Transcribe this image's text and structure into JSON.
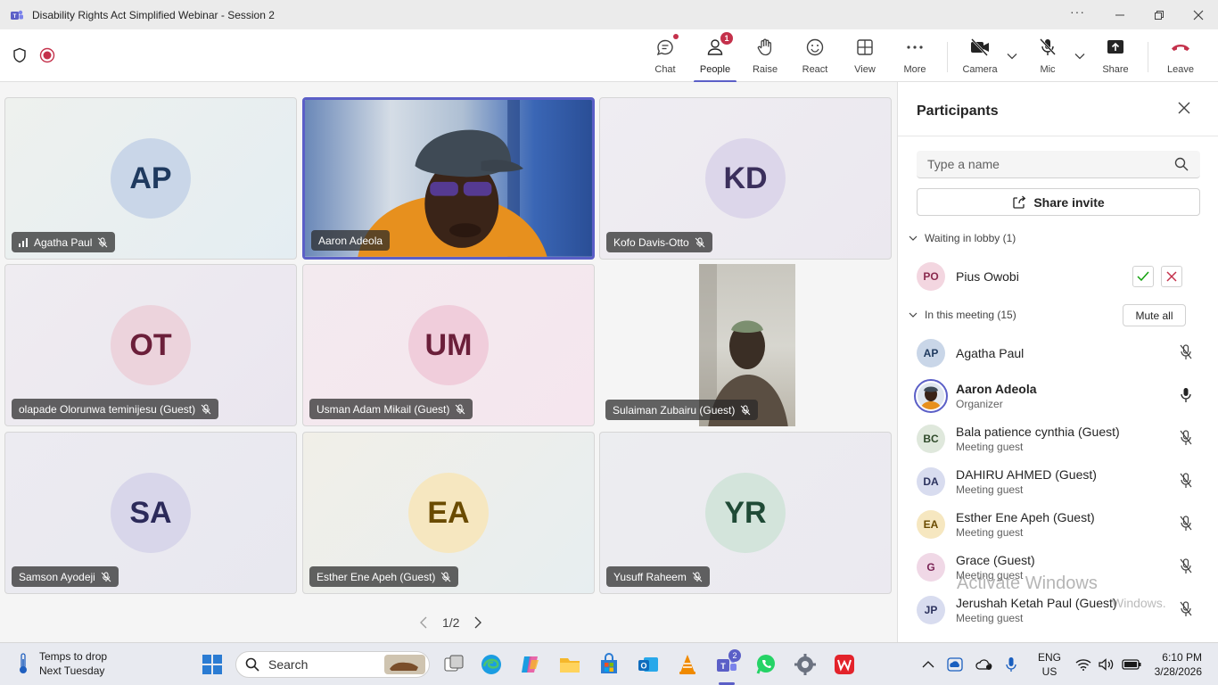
{
  "window": {
    "title": "Disability Rights Act Simplified Webinar - Session 2",
    "more_glyph": "···"
  },
  "toolbar": {
    "items": [
      {
        "label": "Chat",
        "icon": "chat-icon"
      },
      {
        "label": "People",
        "icon": "people-icon",
        "badge": "1"
      },
      {
        "label": "Raise",
        "icon": "raise-hand-icon"
      },
      {
        "label": "React",
        "icon": "react-emoji-icon"
      },
      {
        "label": "View",
        "icon": "view-grid-icon"
      },
      {
        "label": "More",
        "icon": "more-icon"
      },
      {
        "label": "Camera",
        "icon": "camera-off-icon"
      },
      {
        "label": "Mic",
        "icon": "mic-off-icon"
      },
      {
        "label": "Share",
        "icon": "share-icon"
      },
      {
        "label": "Leave",
        "icon": "leave-icon"
      }
    ]
  },
  "tiles": [
    {
      "name": "Agatha Paul",
      "initials": "AP",
      "bg": "#e9eff0",
      "avatar_bg": "#c9d6e8",
      "avatar_fg": "#1f3a5f",
      "signal": true
    },
    {
      "name": "Aaron Adeola",
      "video": true,
      "speaking": true
    },
    {
      "name": "Kofo Davis-Otto",
      "initials": "KD",
      "bg": "#eeecf2",
      "avatar_bg": "#dcd6ea",
      "avatar_fg": "#3b2f5c"
    },
    {
      "name": "olapade Olorunwa teminijesu (Guest)",
      "initials": "OT",
      "bg": "#efebf0",
      "avatar_bg": "#ecd3dc",
      "avatar_fg": "#6b1f3a"
    },
    {
      "name": "Usman Adam Mikail (Guest)",
      "initials": "UM",
      "bg": "#f3e9ee",
      "avatar_bg": "#f0cddb",
      "avatar_fg": "#6b1f3a"
    },
    {
      "name": "Sulaiman Zubairu (Guest)",
      "video": true
    },
    {
      "name": "Samson Ayodeji",
      "initials": "SA",
      "bg": "#ebebf2",
      "avatar_bg": "#d8d6ea",
      "avatar_fg": "#2c2a5a"
    },
    {
      "name": "Esther Ene Apeh (Guest)",
      "initials": "EA",
      "bg": "#eef0ec",
      "avatar_bg": "#f6e7c0",
      "avatar_fg": "#6a4b00"
    },
    {
      "name": "Yusuff Raheem",
      "initials": "YR",
      "bg": "#ececf1",
      "avatar_bg": "#d3e4db",
      "avatar_fg": "#1f4a36"
    }
  ],
  "pager": {
    "text": "1/2"
  },
  "panel": {
    "title": "Participants",
    "search_placeholder": "Type a name",
    "share_invite": "Share invite",
    "lobby_header": "Waiting in lobby (1)",
    "meeting_header": "In this meeting (15)",
    "mute_all": "Mute all",
    "lobby": [
      {
        "initials": "PO",
        "name": "Pius Owobi",
        "avatar_bg": "#f3d6e0",
        "avatar_fg": "#8a2a4e"
      }
    ],
    "participants": [
      {
        "initials": "AP",
        "name": "Agatha Paul",
        "sub": "",
        "avatar_bg": "#c9d6e8",
        "avatar_fg": "#1f3a5f",
        "mic": "muted"
      },
      {
        "initials": "",
        "name": "Aaron Adeola",
        "sub": "Organizer",
        "photo": true,
        "mic": "on",
        "bold": true
      },
      {
        "initials": "BC",
        "name": "Bala patience cynthia (Guest)",
        "sub": "Meeting guest",
        "avatar_bg": "#dfe8dc",
        "avatar_fg": "#2f4a2a",
        "mic": "muted"
      },
      {
        "initials": "DA",
        "name": "DAHIRU AHMED (Guest)",
        "sub": "Meeting guest",
        "avatar_bg": "#d8dcef",
        "avatar_fg": "#2c325e",
        "mic": "muted"
      },
      {
        "initials": "EA",
        "name": "Esther Ene Apeh (Guest)",
        "sub": "Meeting guest",
        "avatar_bg": "#f6e7c0",
        "avatar_fg": "#6a4b00",
        "mic": "muted"
      },
      {
        "initials": "G",
        "name": "Grace (Guest)",
        "sub": "Meeting guest",
        "avatar_bg": "#f0d8e6",
        "avatar_fg": "#7a2455",
        "mic": "muted"
      },
      {
        "initials": "JP",
        "name": "Jerushah Ketah Paul (Guest)",
        "sub": "Meeting guest",
        "avatar_bg": "#d8dcef",
        "avatar_fg": "#2c325e",
        "mic": "muted"
      }
    ]
  },
  "watermark": {
    "line1": "Activate Windows",
    "line2": "Windows."
  },
  "taskbar": {
    "weather_line1": "Temps to drop",
    "weather_line2": "Next Tuesday",
    "search_placeholder": "Search",
    "teams_badge": "2",
    "lang_line1": "ENG",
    "lang_line2": "US",
    "time": "6:10 PM",
    "date": "3/28/2026"
  }
}
